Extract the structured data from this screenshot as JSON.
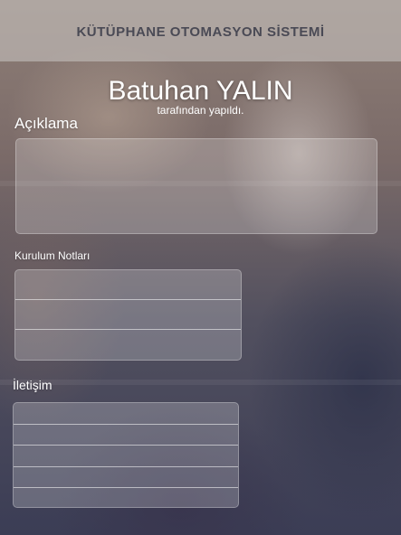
{
  "header": {
    "title": "KÜTÜPHANE OTOMASYON SİSTEMİ"
  },
  "author": {
    "name": "Batuhan YALIN",
    "subtitle": "tarafından yapıldı."
  },
  "sections": {
    "aciklama": {
      "label": "Açıklama"
    },
    "kurulum": {
      "label": "Kurulum Notları",
      "rows": [
        "",
        "",
        ""
      ]
    },
    "iletisim": {
      "label": "İletişim",
      "rows": [
        "",
        "",
        "",
        "",
        ""
      ]
    }
  }
}
